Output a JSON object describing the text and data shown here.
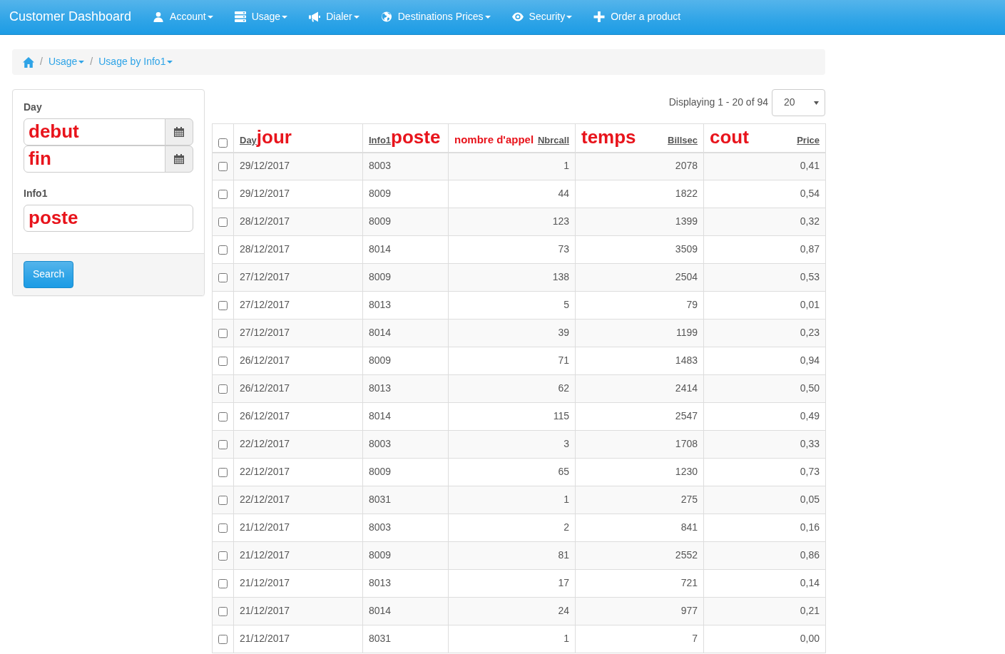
{
  "navbar": {
    "brand": "Customer Dashboard",
    "items": [
      {
        "label": "Account",
        "dropdown": true
      },
      {
        "label": "Usage",
        "dropdown": true
      },
      {
        "label": "Dialer",
        "dropdown": true
      },
      {
        "label": "Destinations Prices",
        "dropdown": true
      },
      {
        "label": "Security",
        "dropdown": true
      },
      {
        "label": "Order a product",
        "dropdown": false
      }
    ]
  },
  "breadcrumb": {
    "separator": "/",
    "items": [
      {
        "label": "Usage",
        "dropdown": true
      },
      {
        "label": "Usage by Info1",
        "dropdown": true
      }
    ]
  },
  "filter": {
    "fields": [
      {
        "label": "Day",
        "kind": "date-range",
        "values": [
          "debut",
          "fin"
        ]
      },
      {
        "label": "Info1",
        "kind": "text",
        "values": [
          "poste"
        ]
      }
    ],
    "button": "Search"
  },
  "pagination": {
    "summary": "Displaying 1 - 20 of 94",
    "page_size": "20"
  },
  "table": {
    "all_checked": false,
    "columns": [
      {
        "label": "Day",
        "note": "jour",
        "kind": "text"
      },
      {
        "label": "Info1",
        "note": "poste",
        "kind": "text"
      },
      {
        "label": "Nbrcall",
        "note": "nombre d'appel",
        "kind": "number"
      },
      {
        "label": "Billsec",
        "note": "temps",
        "kind": "number"
      },
      {
        "label": "Price",
        "note": "cout",
        "kind": "number"
      }
    ],
    "rows": [
      {
        "checked": false,
        "cells": [
          "29/12/2017",
          "8003",
          "1",
          "2078",
          "0,41"
        ]
      },
      {
        "checked": false,
        "cells": [
          "29/12/2017",
          "8009",
          "44",
          "1822",
          "0,54"
        ]
      },
      {
        "checked": false,
        "cells": [
          "28/12/2017",
          "8009",
          "123",
          "1399",
          "0,32"
        ]
      },
      {
        "checked": false,
        "cells": [
          "28/12/2017",
          "8014",
          "73",
          "3509",
          "0,87"
        ]
      },
      {
        "checked": false,
        "cells": [
          "27/12/2017",
          "8009",
          "138",
          "2504",
          "0,53"
        ]
      },
      {
        "checked": false,
        "cells": [
          "27/12/2017",
          "8013",
          "5",
          "79",
          "0,01"
        ]
      },
      {
        "checked": false,
        "cells": [
          "27/12/2017",
          "8014",
          "39",
          "1199",
          "0,23"
        ]
      },
      {
        "checked": false,
        "cells": [
          "26/12/2017",
          "8009",
          "71",
          "1483",
          "0,94"
        ]
      },
      {
        "checked": false,
        "cells": [
          "26/12/2017",
          "8013",
          "62",
          "2414",
          "0,50"
        ]
      },
      {
        "checked": false,
        "cells": [
          "26/12/2017",
          "8014",
          "115",
          "2547",
          "0,49"
        ]
      },
      {
        "checked": false,
        "cells": [
          "22/12/2017",
          "8003",
          "3",
          "1708",
          "0,33"
        ]
      },
      {
        "checked": false,
        "cells": [
          "22/12/2017",
          "8009",
          "65",
          "1230",
          "0,73"
        ]
      },
      {
        "checked": false,
        "cells": [
          "22/12/2017",
          "8031",
          "1",
          "275",
          "0,05"
        ]
      },
      {
        "checked": false,
        "cells": [
          "21/12/2017",
          "8003",
          "2",
          "841",
          "0,16"
        ]
      },
      {
        "checked": false,
        "cells": [
          "21/12/2017",
          "8009",
          "81",
          "2552",
          "0,86"
        ]
      },
      {
        "checked": false,
        "cells": [
          "21/12/2017",
          "8013",
          "17",
          "721",
          "0,14"
        ]
      },
      {
        "checked": false,
        "cells": [
          "21/12/2017",
          "8014",
          "24",
          "977",
          "0,21"
        ]
      },
      {
        "checked": false,
        "cells": [
          "21/12/2017",
          "8031",
          "1",
          "7",
          "0,00"
        ]
      }
    ]
  }
}
